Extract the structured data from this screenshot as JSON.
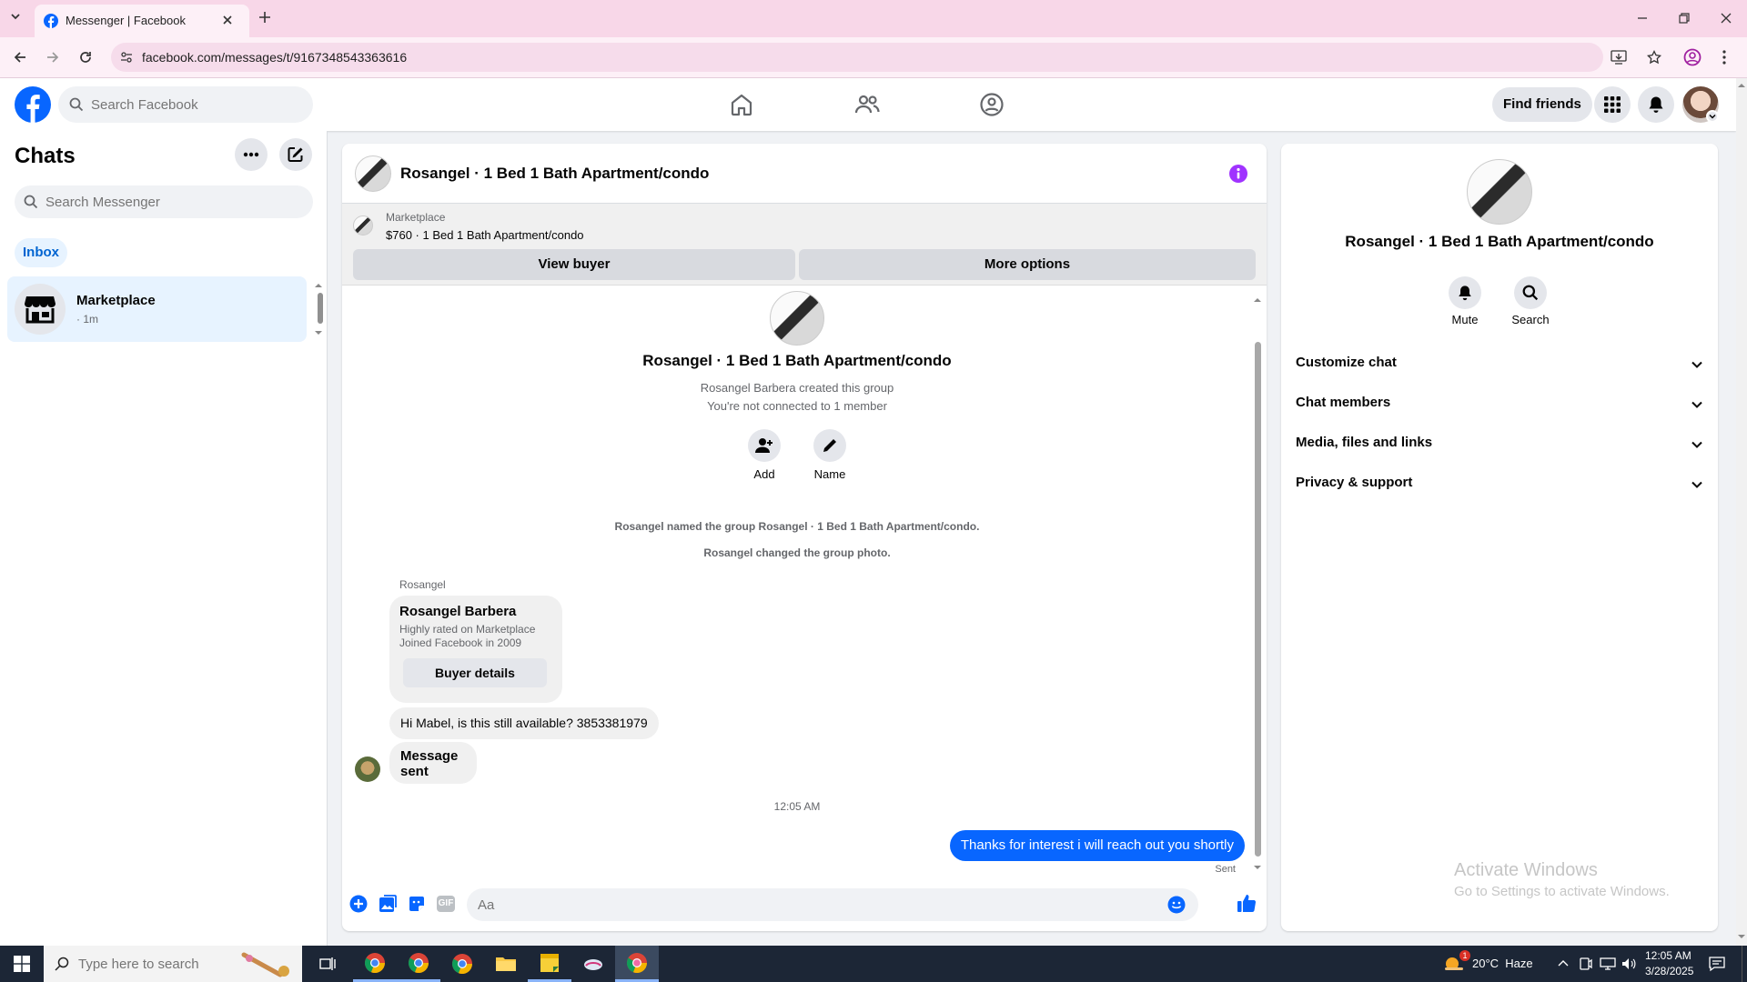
{
  "browser": {
    "tab_title": "Messenger | Facebook",
    "url": "facebook.com/messages/t/9167348543363616"
  },
  "fb_header": {
    "search_placeholder": "Search Facebook",
    "find_friends_label": "Find friends"
  },
  "sidebar": {
    "title": "Chats",
    "search_placeholder": "Search Messenger",
    "filter_label": "Inbox",
    "chats": [
      {
        "name": "Marketplace",
        "time": "· 1m"
      }
    ]
  },
  "conversation": {
    "header_title": "Rosangel · 1 Bed 1 Bath Apartment/condo",
    "banner_source": "Marketplace",
    "banner_listing": "$760 · 1 Bed 1 Bath Apartment/condo",
    "view_buyer_label": "View buyer",
    "more_options_label": "More options",
    "group_title": "Rosangel · 1 Bed 1 Bath Apartment/condo",
    "group_created": "Rosangel Barbera created this group",
    "group_connection": "You're not connected to 1 member",
    "add_label": "Add",
    "name_label": "Name",
    "event_rename": "Rosangel named the group Rosangel · 1 Bed 1 Bath Apartment/condo.",
    "event_photo": "Rosangel changed the group photo.",
    "sender_name": "Rosangel",
    "card_name": "Rosangel Barbera",
    "card_line1": "Highly rated on Marketplace",
    "card_line2": "Joined Facebook in 2009",
    "buyer_details_label": "Buyer details",
    "msg1": "Hi Mabel, is this still available? 3853381979",
    "msg2": "Message sent",
    "timestamp": "12:05 AM",
    "my_msg": "Thanks for interest i will reach out you shortly",
    "status": "Sent",
    "composer_placeholder": "Aa",
    "gif_label": "GIF"
  },
  "details": {
    "title": "Rosangel · 1 Bed 1 Bath Apartment/condo",
    "mute_label": "Mute",
    "search_label": "Search",
    "sections": [
      "Customize chat",
      "Chat members",
      "Media, files and links",
      "Privacy & support"
    ],
    "watermark_line1": "Activate Windows",
    "watermark_line2": "Go to Settings to activate Windows."
  },
  "taskbar": {
    "search_placeholder": "Type here to search",
    "weather": "20°C  Haze",
    "weather_badge": "1",
    "time": "12:05 AM",
    "date": "3/28/2025"
  },
  "colors": {
    "fb_blue": "#0866ff",
    "tab_strip": "#f8d7e8",
    "info_purple": "#a033ff",
    "taskbar": "#1c2636"
  },
  "icons": [
    "chevron-down-icon",
    "facebook-favicon-icon",
    "close-icon",
    "plus-icon",
    "back-icon",
    "forward-icon",
    "reload-icon",
    "site-info-icon",
    "install-icon",
    "star-icon",
    "profile-icon",
    "kebab-icon",
    "minimize-icon",
    "restore-icon",
    "facebook-logo-icon",
    "search-icon",
    "home-icon",
    "friends-icon",
    "groups-icon",
    "menu-grid-icon",
    "bell-icon",
    "avatar",
    "more-icon",
    "compose-icon",
    "marketplace-store-icon",
    "info-icon",
    "add-person-icon",
    "pencil-icon",
    "emoji-icon",
    "like-icon",
    "image-icon",
    "sticker-icon",
    "windows-logo-icon",
    "task-view-icon"
  ]
}
